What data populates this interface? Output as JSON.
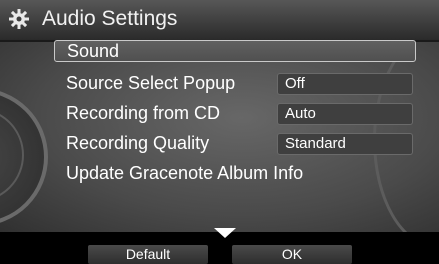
{
  "header": {
    "title": "Audio Settings",
    "icon": "gear-icon"
  },
  "menu": {
    "items": [
      {
        "label": "Sound",
        "value": ""
      },
      {
        "label": "Source Select Popup",
        "value": "Off"
      },
      {
        "label": "Recording from CD",
        "value": "Auto"
      },
      {
        "label": "Recording Quality",
        "value": "Standard"
      },
      {
        "label": "Update Gracenote Album Info",
        "value": ""
      }
    ]
  },
  "softkeys": {
    "default_label": "Default",
    "ok_label": "OK"
  }
}
